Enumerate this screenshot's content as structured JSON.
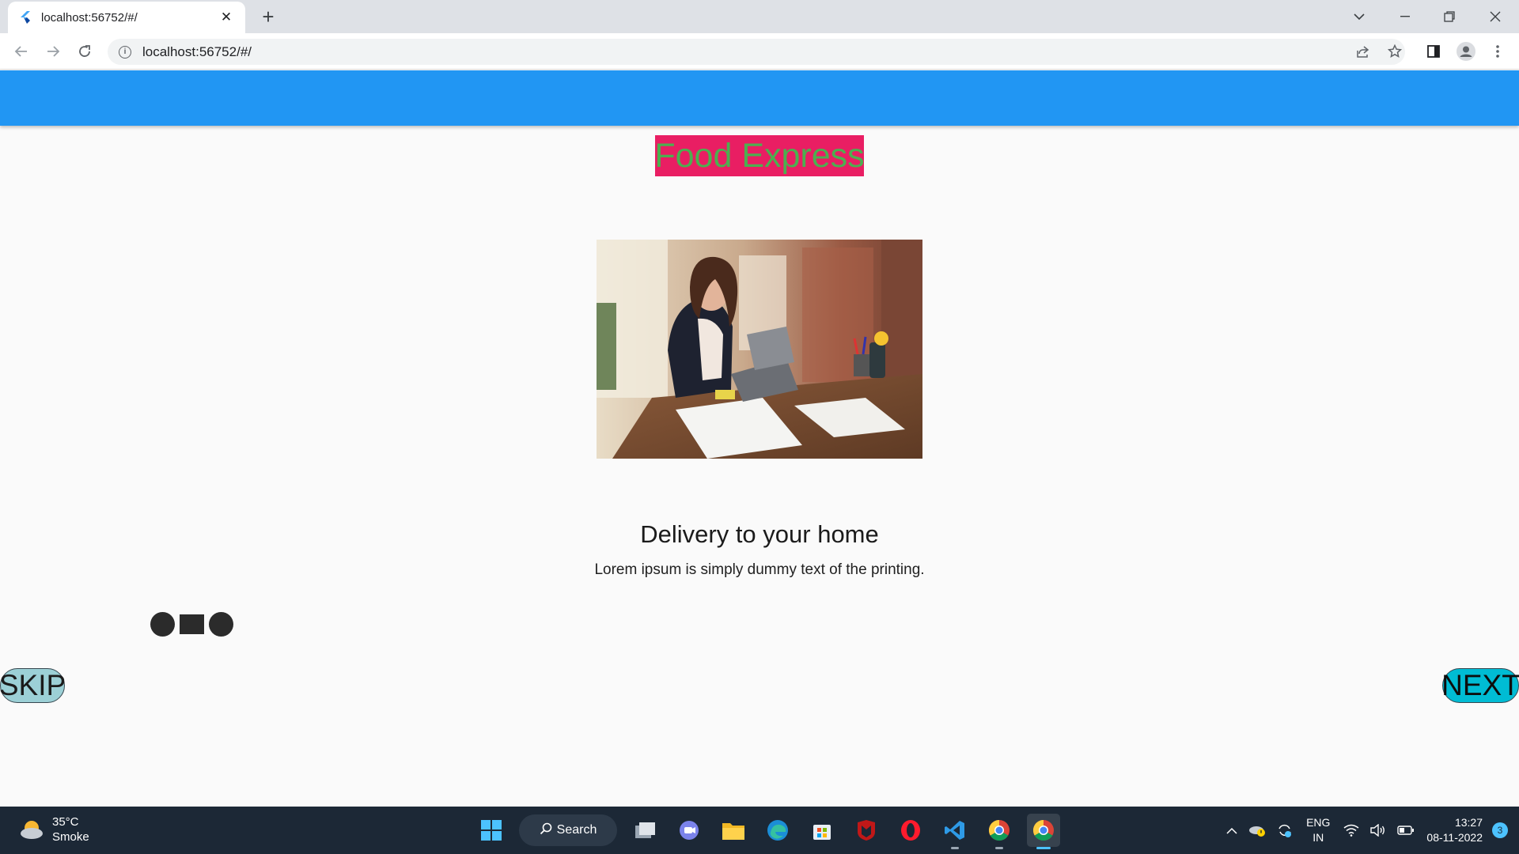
{
  "browser": {
    "tab_title": "localhost:56752/#/",
    "url": "localhost:56752/#/",
    "new_tab_symbol": "+",
    "close_symbol": "✕"
  },
  "app": {
    "brand_title": "Food Express",
    "headline": "Delivery to your home",
    "description": "Lorem ipsum is simply dummy text of the printing.",
    "page_indicator": {
      "count": 3,
      "active_index": 1
    },
    "skip_label": "SKIP",
    "next_label": "NEXT",
    "colors": {
      "appbar": "#2196f3",
      "brand_bg": "#e91e63",
      "brand_text": "#4caf50",
      "skip_bg": "#9cd0d6",
      "next_bg": "#00bcd4"
    }
  },
  "taskbar": {
    "weather_temp": "35°C",
    "weather_desc": "Smoke",
    "search_label": "Search",
    "lang_primary": "ENG",
    "lang_secondary": "IN",
    "time": "13:27",
    "date": "08-11-2022",
    "notification_count": "3",
    "pinned_apps": [
      "start-icon",
      "search",
      "task-view-icon",
      "teams-chat-icon",
      "file-explorer-icon",
      "edge-icon",
      "microsoft-store-icon",
      "mcafee-icon",
      "opera-icon",
      "vscode-icon",
      "chrome-icon",
      "chrome-active-icon"
    ]
  }
}
